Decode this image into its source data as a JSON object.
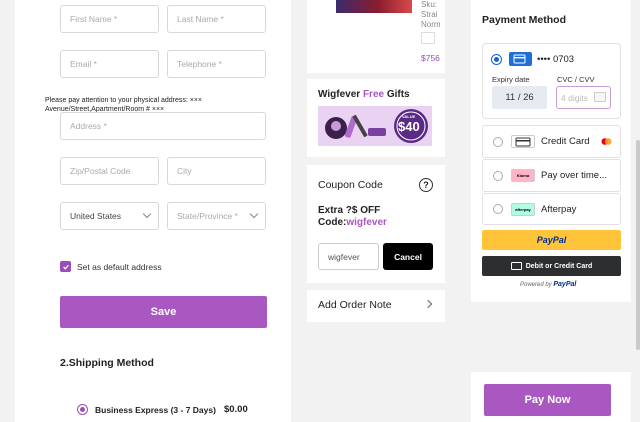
{
  "address_form": {
    "first_name_placeholder": "First Name *",
    "last_name_placeholder": "Last Name *",
    "email_placeholder": "Email *",
    "telephone_placeholder": "Telephone *",
    "address_note": "Please pay attention to your physical address: ××× Avenue/Street,Apartment/Room # ×××",
    "address_placeholder": "Address *",
    "zip_placeholder": "Zip/Postal Code",
    "city_placeholder": "City",
    "country_value": "United States",
    "state_placeholder": "State/Province *",
    "default_address_label": "Set as default address",
    "default_address_checked": true,
    "save_label": "Save"
  },
  "shipping": {
    "title": "2.Shipping Method",
    "option_label": "Business Express (3 - 7 Days)",
    "option_price": "$0.00"
  },
  "product": {
    "text": "Sku: Strai Norm",
    "price": "$756"
  },
  "gifts": {
    "title_prefix": "Wigfever",
    "title_free": "Free",
    "title_suffix": "Gifts",
    "banner_value_label": "VALUE",
    "banner_value": "$40"
  },
  "coupon": {
    "title": "Coupon Code",
    "help_icon": "question-circle-icon",
    "offer_line1": "Extra ?$ OFF",
    "offer_code_prefix": "Code:",
    "offer_code": "wigfever",
    "input_value": "wigfever",
    "cancel_label": "Cancel"
  },
  "order_note": {
    "label": "Add Order Note"
  },
  "payment": {
    "title": "Payment Method",
    "saved_card_number": "•••• 0703",
    "expiry_label": "Expiry date",
    "expiry_value": "11 / 26",
    "cvc_label": "CVC / CVV",
    "cvc_placeholder": "4 digits",
    "options": [
      {
        "label": "Credit Card",
        "logo": "credit-card-icon"
      },
      {
        "label": "Pay over time...",
        "logo": "klarna-logo",
        "logo_text": "Klarna"
      },
      {
        "label": "Afterpay",
        "logo": "afterpay-logo",
        "logo_text": "afterpay"
      }
    ],
    "paypal_label": "PayPal",
    "debit_label": "Debit or Credit Card",
    "powered_by": "Powered by",
    "powered_brand": "PayPal",
    "pay_now_label": "Pay Now"
  },
  "colors": {
    "accent": "#a957c1",
    "paypal_yellow": "#ffc439",
    "debit_black": "#2c2e2f"
  }
}
